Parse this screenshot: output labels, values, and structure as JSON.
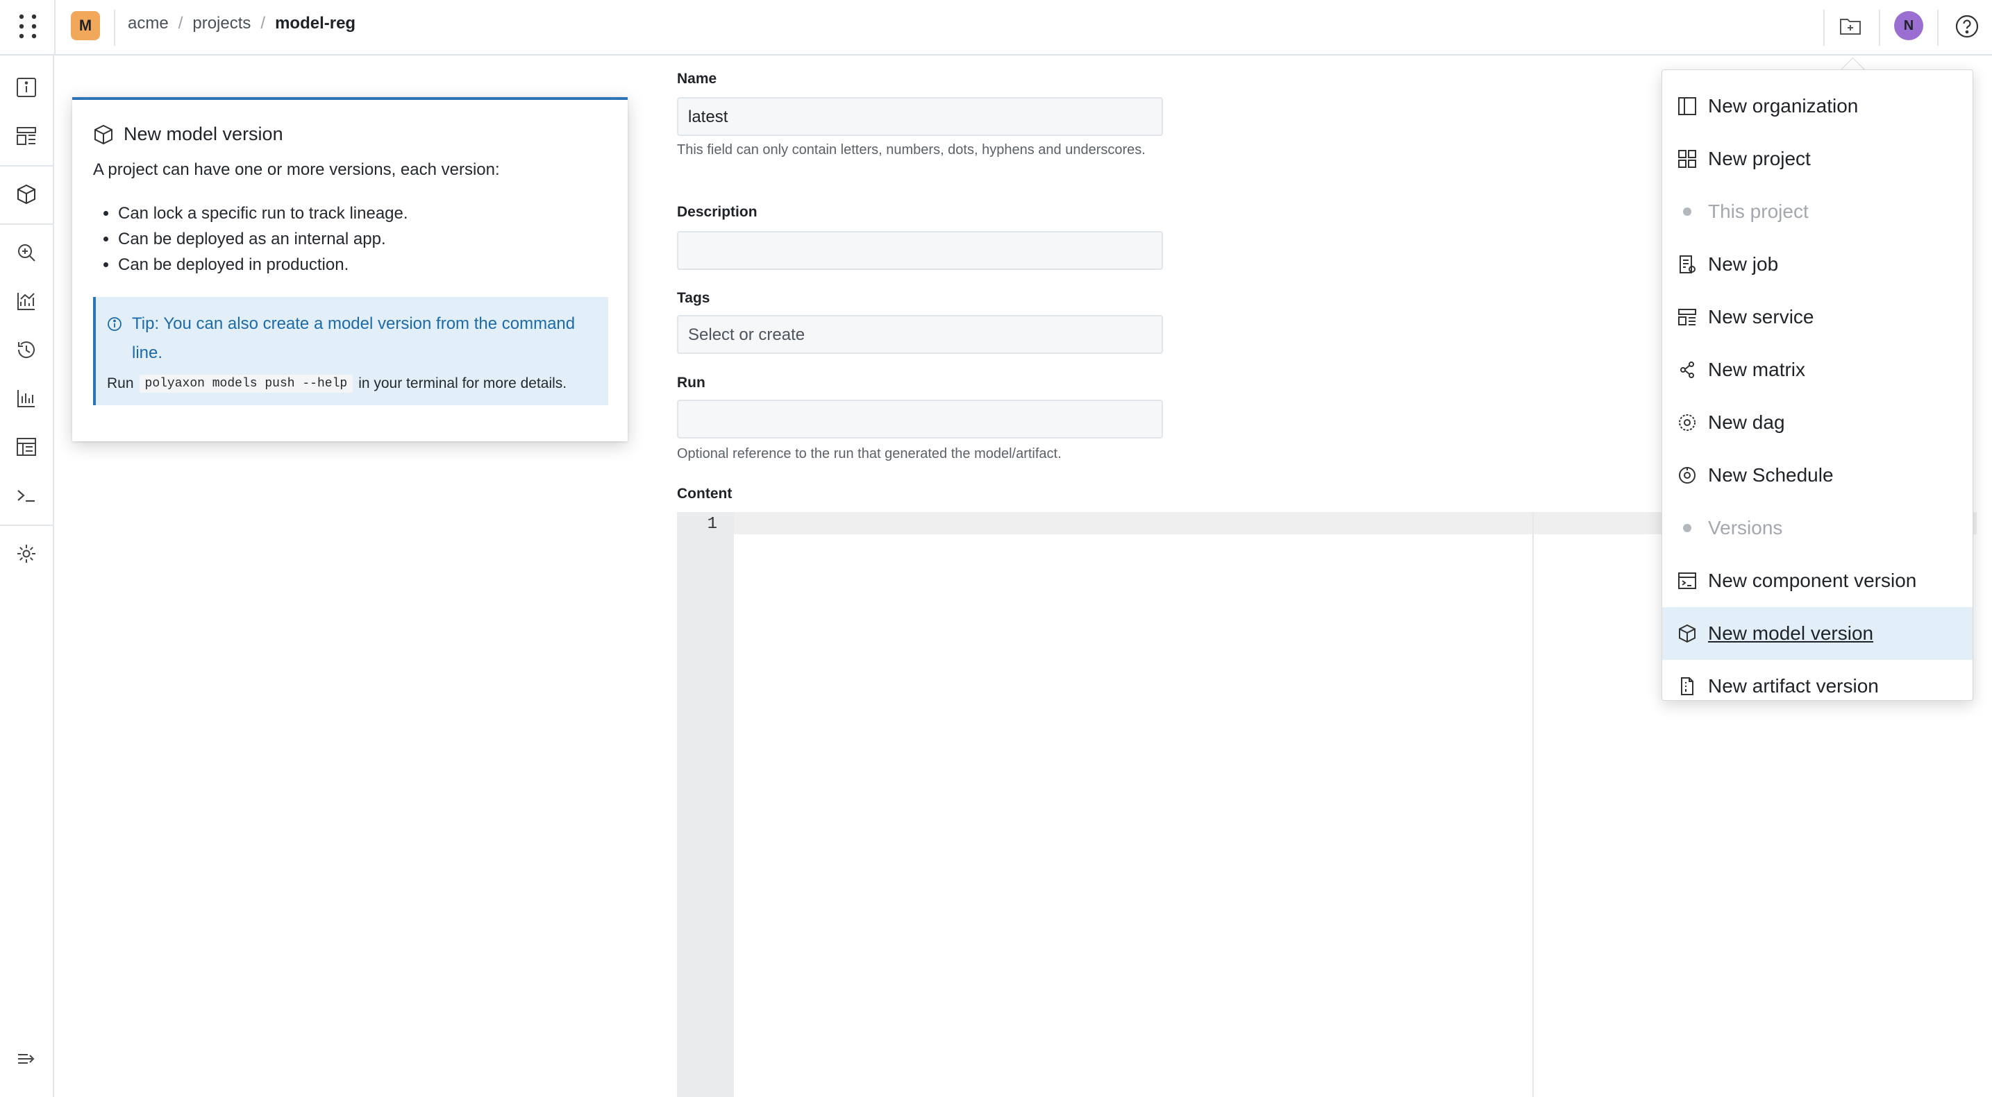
{
  "header": {
    "org_initial": "M",
    "breadcrumb": [
      "acme",
      "projects",
      "model-reg"
    ],
    "user_initial": "N"
  },
  "help_card": {
    "title": "New model version",
    "intro": "A project can have one or more versions, each version:",
    "bullets": [
      "Can lock a specific run to track lineage.",
      "Can be deployed as an internal app.",
      "Can be deployed in production."
    ],
    "tip": "Tip: You can also create a model version from the command line.",
    "run_prefix": "Run",
    "run_command": "polyaxon models push --help",
    "run_suffix": "in your terminal for more details."
  },
  "form": {
    "name_label": "Name",
    "name_value": "latest",
    "name_help": "This field can only contain letters, numbers, dots, hyphens and underscores.",
    "description_label": "Description",
    "description_value": "",
    "tags_label": "Tags",
    "tags_placeholder": "Select or create",
    "run_label": "Run",
    "run_value": "",
    "run_help": "Optional reference to the run that generated the model/artifact.",
    "content_label": "Content",
    "line_number": "1"
  },
  "menu": {
    "items": [
      {
        "label": "New organization",
        "icon": "organization-icon",
        "state": "normal"
      },
      {
        "label": "New project",
        "icon": "project-icon",
        "state": "normal"
      },
      {
        "label": "This project",
        "icon": "dot-icon",
        "state": "disabled"
      },
      {
        "label": "New job",
        "icon": "job-icon",
        "state": "normal"
      },
      {
        "label": "New service",
        "icon": "service-icon",
        "state": "normal"
      },
      {
        "label": "New matrix",
        "icon": "matrix-icon",
        "state": "normal"
      },
      {
        "label": "New dag",
        "icon": "dag-icon",
        "state": "normal"
      },
      {
        "label": "New Schedule",
        "icon": "schedule-icon",
        "state": "normal"
      },
      {
        "label": "Versions",
        "icon": "dot-icon",
        "state": "disabled"
      },
      {
        "label": "New component version",
        "icon": "component-icon",
        "state": "normal"
      },
      {
        "label": "New model version",
        "icon": "model-icon",
        "state": "active"
      },
      {
        "label": "New artifact version",
        "icon": "artifact-icon",
        "state": "normal"
      }
    ]
  },
  "colors": {
    "accent": "#2f74b5",
    "org_badge": "#f2a85b",
    "avatar": "#9b6fd1",
    "highlight": "#e3eff8"
  }
}
